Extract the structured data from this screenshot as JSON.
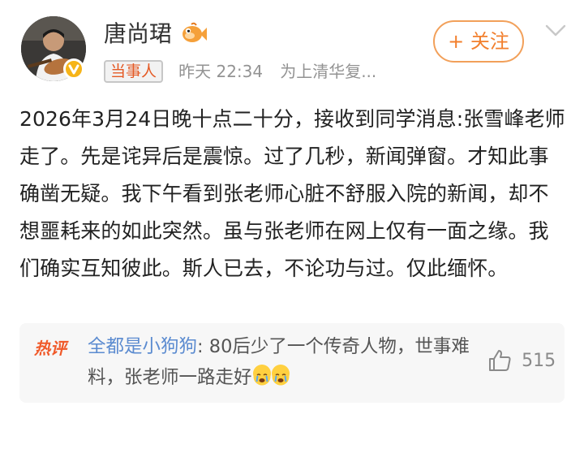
{
  "author": {
    "name": "唐尚珺",
    "avatar_icon": "avatar-guitar-icon",
    "verified_icon": "verified-badge-icon",
    "fan_icon": "fish-badge-icon",
    "follow_label": "+ 关注",
    "more_icon": "chevron-down-icon"
  },
  "meta": {
    "role_badge": "当事人",
    "time": "昨天 22:34",
    "source": "为上清华复..."
  },
  "post": {
    "text": "2026年3月24日晚十点二十分，接收到同学消息:张雪峰老师走了。先是诧异后是震惊。过了几秒，新闻弹窗。才知此事确凿无疑。我下午看到张老师心脏不舒服入院的新闻，却不想噩耗来的如此突然。虽与张老师在网上仅有一面之缘。我们确实互知彼此。斯人已去，不论功与过。仅此缅怀。"
  },
  "hot_comment": {
    "tag": "热评",
    "author": "全都是小狗狗",
    "separator": ": ",
    "text": "80后少了一个传奇人物，世事难料，张老师一路走好",
    "emoji_icon": "crying-face-icon",
    "like_icon": "thumb-up-icon",
    "likes": "515"
  },
  "colors": {
    "accent_orange": "#f27f2d",
    "link_blue": "#5b8bd0",
    "hot_red": "#f05a2a",
    "badge_yellow": "#f6b418"
  }
}
